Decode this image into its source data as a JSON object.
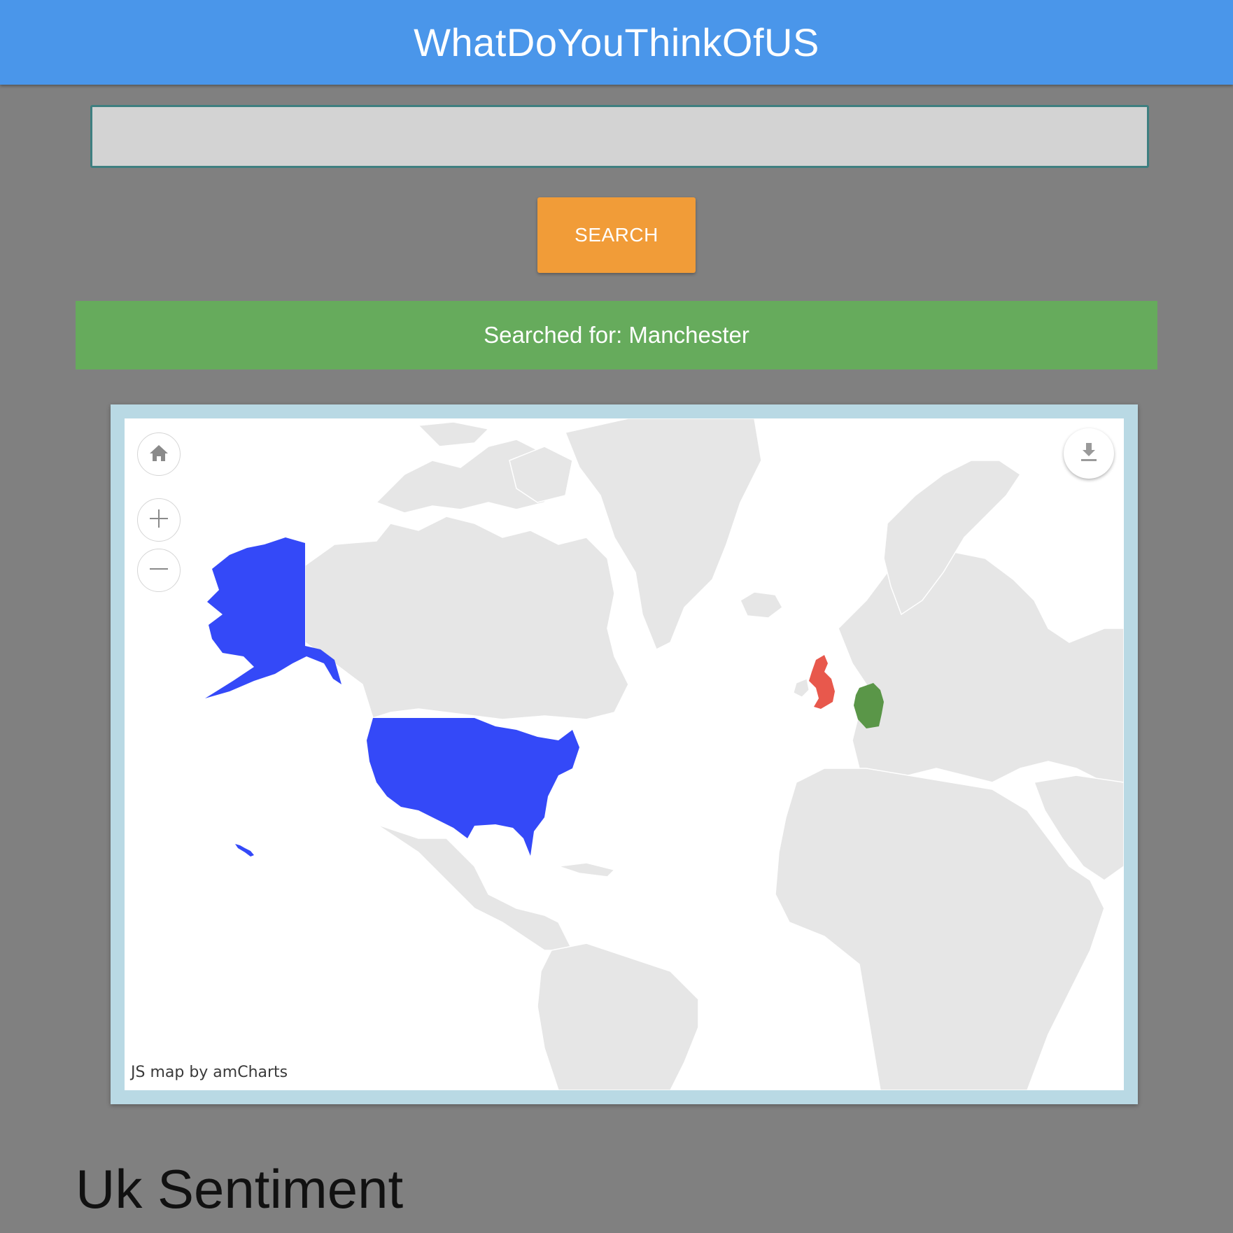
{
  "header": {
    "title": "WhatDoYouThinkOfUS"
  },
  "search": {
    "value": "",
    "placeholder": "",
    "button_label": "SEARCH"
  },
  "status": {
    "message": "Searched for: Manchester"
  },
  "map": {
    "credit": "JS map by amCharts",
    "controls": [
      "home-icon",
      "zoom-in-icon",
      "zoom-out-icon",
      "download-icon"
    ],
    "highlighted_regions": [
      {
        "name": "United States",
        "color": "#3449f8"
      },
      {
        "name": "United Kingdom",
        "color": "#e8584c"
      },
      {
        "name": "Germany",
        "color": "#5a9648"
      }
    ],
    "land_color": "#e6e6e6"
  },
  "section": {
    "heading": "Uk Sentiment"
  }
}
